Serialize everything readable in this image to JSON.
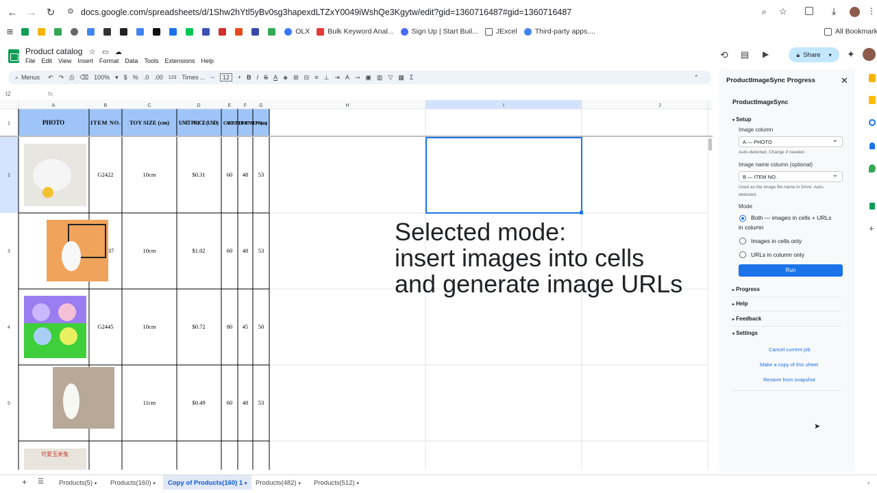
{
  "browser": {
    "url": "docs.google.com/spreadsheets/d/1Shw2hYtl5yBv0sg3hapexdLTZxY0049iWshQe3Kgytw/edit?gid=1360716487#gid=1360716487",
    "bookmarks": [
      "OLX",
      "Bulk Keyword Anal...",
      "Sign Up | Start Buil...",
      "JExcel",
      "Third-party apps...."
    ],
    "all_bookmarks": "All Bookmarks"
  },
  "app": {
    "title": "Product catalog",
    "menus": [
      "File",
      "Edit",
      "View",
      "Insert",
      "Format",
      "Data",
      "Tools",
      "Extensions",
      "Help"
    ],
    "share": "Share"
  },
  "toolbar": {
    "menus": "Menus",
    "zoom": "100%",
    "currency": "$",
    "percent": "%",
    "dec_dec": ".0",
    "dec_inc": ".00",
    "number": "123",
    "font": "Times ...",
    "font_size": "12"
  },
  "formula": {
    "cell": "I2",
    "fx": "fx"
  },
  "grid": {
    "columns": [
      "A",
      "B",
      "C",
      "D",
      "E",
      "F",
      "G",
      "H",
      "I",
      "J"
    ],
    "headers": [
      "PHOTO",
      "ITEM NO.",
      "TOY SIZE (cm)",
      "UNIT PRICE (USD)",
      "CARTON DIMENSIONS (cm)"
    ],
    "rows": [
      {
        "num": "1"
      },
      {
        "num": "2",
        "item": "G2422",
        "size": "10cm",
        "price": "$0.31",
        "e": "60",
        "f": "48",
        "g": "53"
      },
      {
        "num": "3",
        "item": "37",
        "size": "10cm",
        "price": "$1.02",
        "e": "60",
        "f": "48",
        "g": "53"
      },
      {
        "num": "4",
        "item": "G2445",
        "size": "10cm",
        "price": "$0.72",
        "e": "80",
        "f": "45",
        "g": "50"
      },
      {
        "num": "5",
        "item": "",
        "size": "11cm",
        "price": "$0.49",
        "e": "60",
        "f": "48",
        "g": "53"
      }
    ]
  },
  "overlay": {
    "line1": "Selected mode:",
    "line2": "insert images into cells",
    "line3": "and generate image URLs"
  },
  "sidebar": {
    "panel_title": "ProductImageSync Progress",
    "title": "ProductImageSync",
    "setup": "Setup",
    "image_column_label": "Image column",
    "image_column_value": "A — PHOTO",
    "image_column_help": "Auto-detected. Change if needed.",
    "image_name_label": "Image name column (optional)",
    "image_name_value": "B — ITEM NO.",
    "image_name_help1": "Used as the image file name in Drive. Auto-",
    "image_name_help2": "detected.",
    "mode_label": "Mode",
    "mode_both1": "Both — images in cells + URLs",
    "mode_both2": "in column",
    "mode_images": "Images in cells only",
    "mode_urls": "URLs in column only",
    "run": "Run",
    "progress": "Progress",
    "help": "Help",
    "feedback": "Feedback",
    "settings": "Settings",
    "cancel": "Cancel current job",
    "copy": "Make a copy of this sheet",
    "restore": "Restore from snapshot"
  },
  "sheets": [
    "Products(5)",
    "Products(160)",
    "Copy of Products(160) 1",
    "Products(482)",
    "Products(512)"
  ],
  "colors": {
    "accent": "#1a73e8",
    "header_fill": "#9fc5f8",
    "selected": "#c2dbff"
  }
}
